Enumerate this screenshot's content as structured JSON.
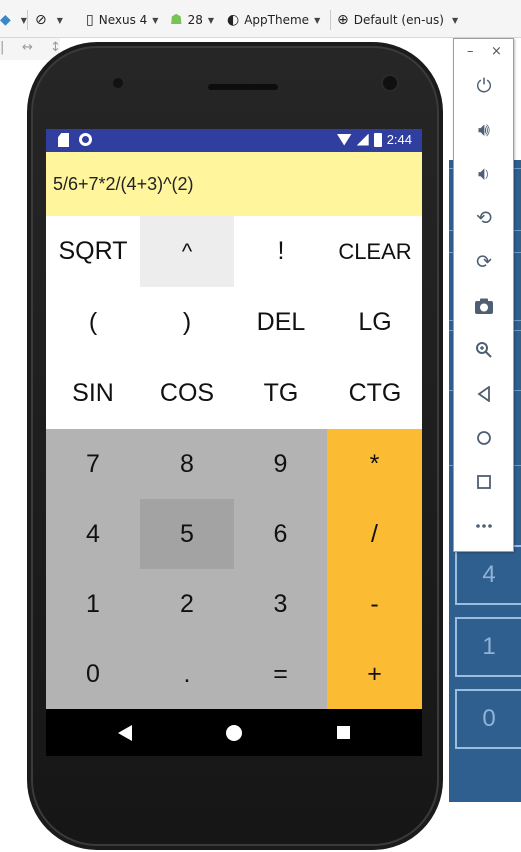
{
  "toolbar": {
    "device": "Nexus 4",
    "api": "28",
    "theme": "AppTheme",
    "locale": "Default (en-us)"
  },
  "statusbar": {
    "time": "2:44"
  },
  "calculator": {
    "expression": "5/6+7*2/(4+3)^(2)",
    "function_rows": [
      [
        "SQRT",
        "^",
        "!",
        "CLEAR"
      ],
      [
        "(",
        ")",
        "DEL",
        "LG"
      ],
      [
        "SIN",
        "COS",
        "TG",
        "CTG"
      ]
    ],
    "number_rows": [
      [
        "7",
        "8",
        "9"
      ],
      [
        "4",
        "5",
        "6"
      ],
      [
        "1",
        "2",
        "3"
      ],
      [
        "0",
        ".",
        "="
      ]
    ],
    "operators": [
      "*",
      "/",
      "-",
      "+"
    ]
  },
  "preview_cells": [
    "4",
    "1",
    "0"
  ],
  "colors": {
    "statusbar": "#303f9f",
    "display": "#fff59d",
    "number_pad": "#b3b3b3",
    "operator_pad": "#fbbc34",
    "navbar": "#000000"
  },
  "emulator_panel": {
    "minimize": "–",
    "close": "×"
  }
}
